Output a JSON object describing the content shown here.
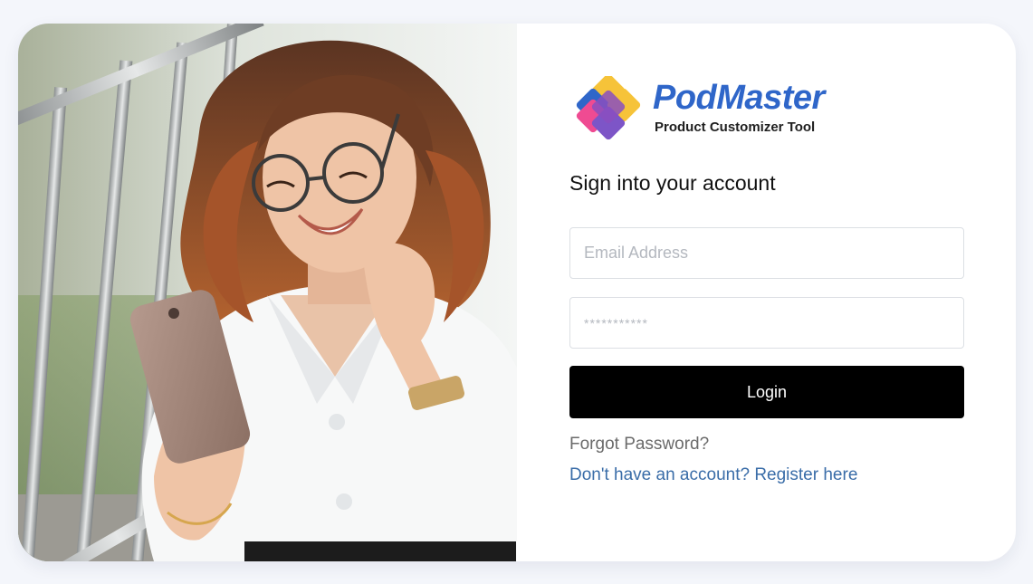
{
  "brand": {
    "name": "PodMaster",
    "tagline": "Product Customizer Tool",
    "colors": {
      "blue": "#2f66c9",
      "yellow": "#f6c339",
      "pink": "#ef4b92",
      "purple": "#7d55c7"
    }
  },
  "hero_image": {
    "icon": "person-with-phone-photo"
  },
  "login": {
    "heading": "Sign into your account",
    "email_placeholder": "Email Address",
    "password_placeholder": "***********",
    "login_label": "Login",
    "forgot_label": "Forgot Password?",
    "register_label": "Don't have an account? Register here"
  },
  "colors": {
    "page_background": "#f4f6fb",
    "button": "#000000",
    "link": "#3a6da8",
    "muted_link": "#6b6b6b"
  }
}
